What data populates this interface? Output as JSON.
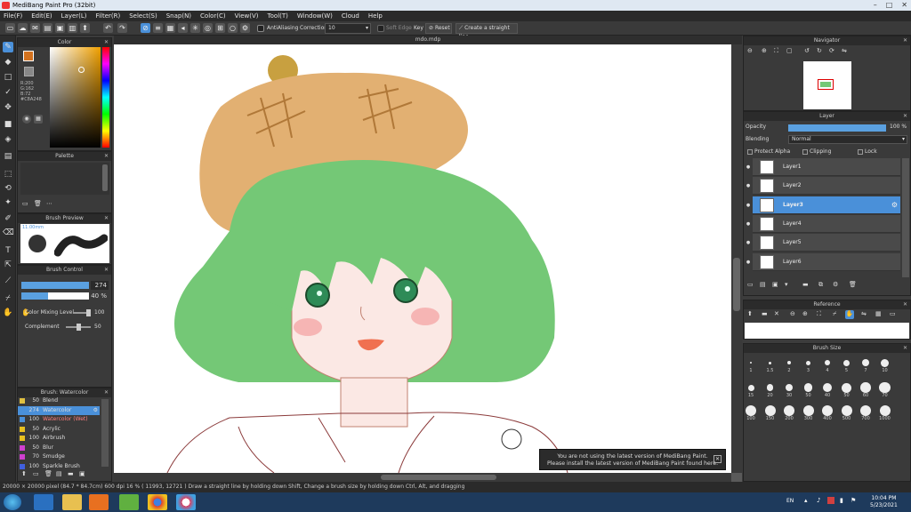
{
  "window": {
    "title": "MediBang Paint Pro (32bit)"
  },
  "menu": [
    "File(F)",
    "Edit(E)",
    "Layer(L)",
    "Filter(R)",
    "Select(S)",
    "Snap(N)",
    "Color(C)",
    "View(V)",
    "Tool(T)",
    "Window(W)",
    "Cloud",
    "Help"
  ],
  "toolbar": {
    "antialiasing": "AntiAliasing",
    "correction_label": "Correction",
    "correction_value": "10",
    "soft_edge": "Soft Edge",
    "key": "Key",
    "reset": "Reset",
    "straight_line": "Create a straight line"
  },
  "document": {
    "tab": "mdo.mdp"
  },
  "color_panel": {
    "title": "Color",
    "r": "R:200",
    "g": "G:162",
    "b": "B:72",
    "hex": "#C8A248",
    "fg": "#d4721e",
    "bg": "#ffffff"
  },
  "palette_panel": {
    "title": "Palette"
  },
  "brush_preview": {
    "title": "Brush Preview",
    "size": "11.00mm"
  },
  "brush_control": {
    "title": "Brush Control",
    "size_value": "274",
    "opacity_value": "40 %",
    "mixing_label": "Color Mixing Level",
    "mixing_value": "100",
    "complement_label": "Complement",
    "complement_value": "50"
  },
  "brush_list": {
    "title": "Brush: Watercolor",
    "items": [
      {
        "size": "50",
        "name": "Blend",
        "color": "#e0c040"
      },
      {
        "size": "274",
        "name": "Watercolor",
        "color": "#4a90d9",
        "active": true
      },
      {
        "size": "100",
        "name": "Watercolor (Wet)",
        "color": "#4a90d9",
        "red": true
      },
      {
        "size": "50",
        "name": "Acrylic",
        "color": "#e8c020"
      },
      {
        "size": "100",
        "name": "Airbrush",
        "color": "#e8c020"
      },
      {
        "size": "50",
        "name": "Blur",
        "color": "#d040d0"
      },
      {
        "size": "70",
        "name": "Smudge",
        "color": "#d040d0"
      },
      {
        "size": "100",
        "name": "Sparkle Brush",
        "color": "#4060e0"
      }
    ]
  },
  "navigator": {
    "title": "Navigator"
  },
  "layer_panel": {
    "title": "Layer",
    "opacity_label": "Opacity",
    "opacity_value": "100 %",
    "opacity_fraction": 1.0,
    "blending_label": "Blending",
    "blending_value": "Normal",
    "protect_alpha": "Protect Alpha",
    "clipping": "Clipping",
    "lock": "Lock",
    "layers": [
      "Layer1",
      "Layer2",
      "Layer3",
      "Layer4",
      "Layer5",
      "Layer6"
    ],
    "active_index": 2
  },
  "reference": {
    "title": "Reference"
  },
  "brush_size": {
    "title": "Brush Size",
    "row1": [
      "1",
      "1.5",
      "2",
      "3",
      "4",
      "5",
      "7",
      "10"
    ],
    "row2": [
      "15",
      "20",
      "30",
      "50",
      "40",
      "50",
      "60",
      "70"
    ],
    "row3": [
      "100",
      "150",
      "200",
      "300",
      "400",
      "500",
      "700",
      "1000"
    ]
  },
  "notification": {
    "line1": "You are not using the latest version of MediBang Paint.",
    "line2": "Please install the latest version of MediBang Paint found here."
  },
  "status": {
    "canvas_size": "20000 × 20000 pixel",
    "physical": "(84.7 * 84.7cm)",
    "dpi": "600 dpi",
    "zoom": "16 %",
    "cursor": "( 11993, 12721 )",
    "hint": "Draw a straight line by holding down Shift, Change a brush size by holding down Ctrl, Alt, and dragging"
  },
  "taskbar": {
    "lang": "EN",
    "time": "10:04 PM",
    "date": "5/23/2021"
  }
}
